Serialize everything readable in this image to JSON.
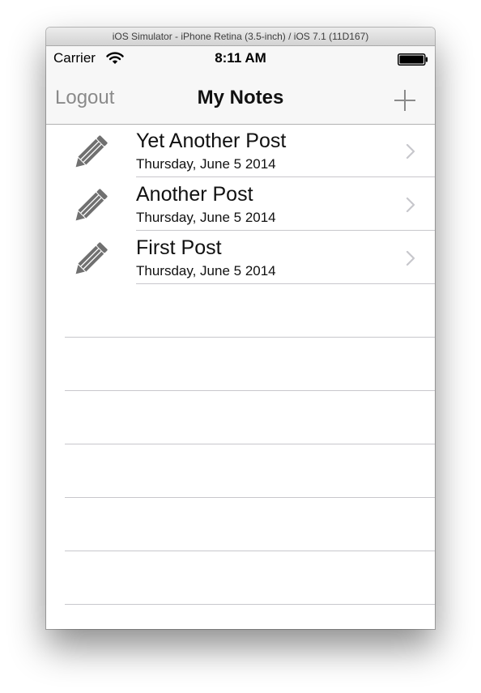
{
  "window": {
    "title": "iOS Simulator - iPhone Retina (3.5-inch) / iOS 7.1 (11D167)"
  },
  "status_bar": {
    "carrier": "Carrier",
    "time": "8:11 AM",
    "wifi_icon": "wifi-icon",
    "battery_icon": "battery-icon"
  },
  "nav_bar": {
    "left_button": "Logout",
    "title": "My Notes",
    "right_icon": "plus-icon"
  },
  "notes": [
    {
      "title": "Yet Another Post",
      "date": "Thursday, June 5 2014",
      "icon": "pencil-icon"
    },
    {
      "title": "Another Post",
      "date": "Thursday, June 5 2014",
      "icon": "pencil-icon"
    },
    {
      "title": "First Post",
      "date": "Thursday, June 5 2014",
      "icon": "pencil-icon"
    }
  ],
  "colors": {
    "bar_background": "#f7f7f7",
    "separator": "#c8c7cc",
    "icon_gray": "#707070",
    "chevron": "#c7c7cc"
  }
}
